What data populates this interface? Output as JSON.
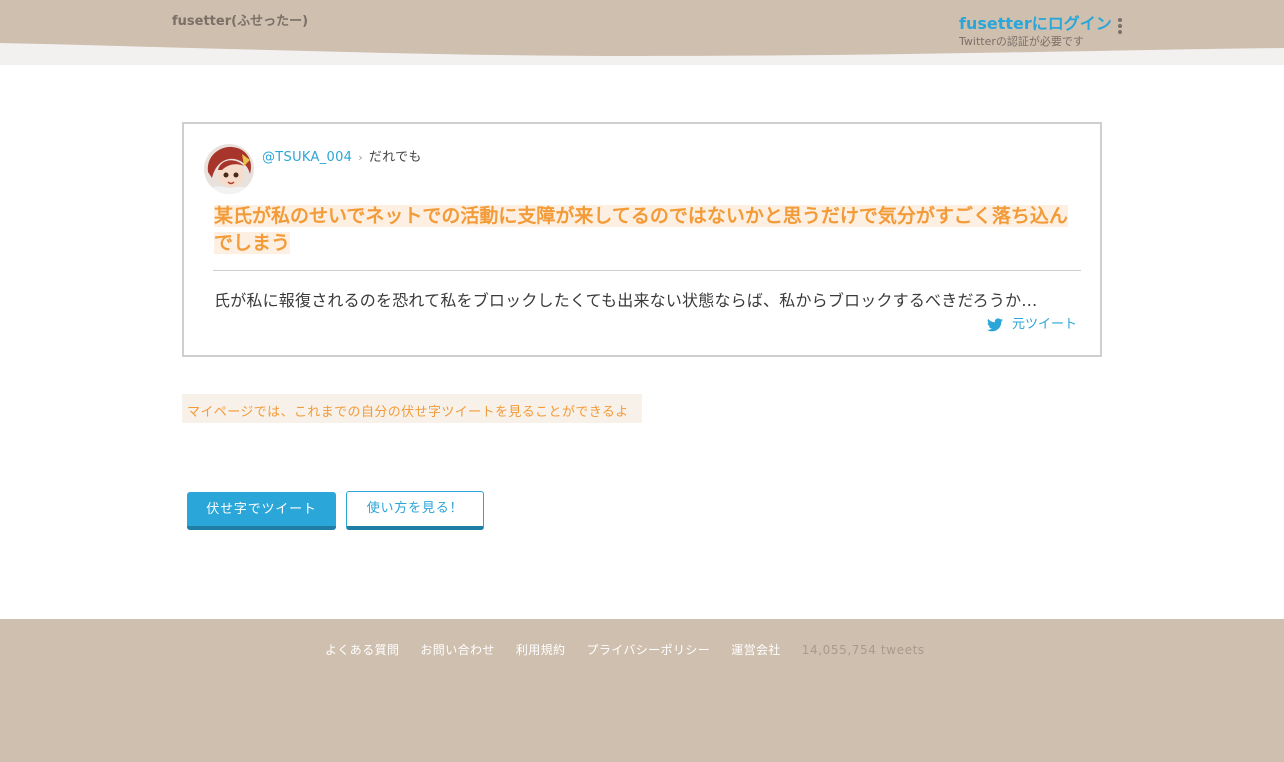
{
  "header": {
    "brand": "fusetter(ふせったー)",
    "login_label": "fusetterにログイン",
    "login_note": "Twitterの認証が必要です",
    "menu_icon": "more-vertical-icon"
  },
  "tweet": {
    "handle": "@TSUKA_004",
    "separator": "›",
    "audience": "だれでも",
    "headline": "某氏が私のせいでネットでの活動に支障が来してるのではないかと思うだけで気分がすごく落ち込んでしまう",
    "body": "氏が私に報復されるのを恐れて私をブロックしたくても出来ない状態ならば、私からブロックするべきだろうか…",
    "original_link": "元ツイート",
    "original_icon": "twitter-bird-icon"
  },
  "hint": "マイページでは、これまでの自分の伏せ字ツイートを見ることができるよ",
  "buttons": {
    "tweet": "伏せ字でツイート",
    "howto": "使い方を見る！"
  },
  "footer": {
    "faq": "よくある質問",
    "contact": "お問い合わせ",
    "terms": "利用規約",
    "privacy": "プライバシーポリシー",
    "company": "運営会社",
    "tweet_count": "14,055,754 tweets"
  },
  "colors": {
    "accent": "#2aa6d8",
    "highlight": "#f29b38",
    "header_bg": "#cfbfaf"
  }
}
